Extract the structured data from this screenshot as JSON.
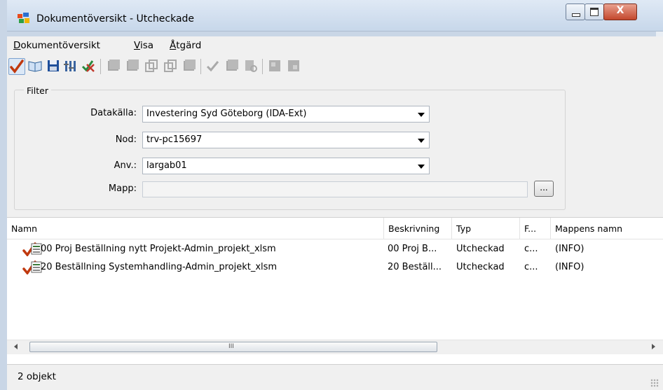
{
  "window": {
    "title": "Dokumentöversikt - Utcheckade",
    "close_glyph": "X"
  },
  "menu": [
    {
      "label_rest": "okumentöversikt",
      "mnemonic": "D"
    },
    {
      "label_rest": "isa",
      "mnemonic": "V"
    },
    {
      "label_rest": "tgärd",
      "mnemonic": "Å"
    }
  ],
  "filter": {
    "legend": "Filter",
    "datakalla_label": "Datakälla:",
    "datakalla_value": "Investering Syd Göteborg (IDA-Ext)",
    "nod_label": "Nod:",
    "nod_value": "trv-pc15697",
    "anv_label": "Anv.:",
    "anv_value": "largab01",
    "mapp_label": "Mapp:",
    "mapp_value": "",
    "browse_label": "..."
  },
  "list": {
    "columns": [
      "Namn",
      "Beskrivning",
      "Typ",
      "F...",
      "Mappens namn"
    ],
    "rows": [
      {
        "namn": "00 Proj Beställning nytt Projekt-Admin_projekt_xlsm",
        "beskrivning": "00 Proj B...",
        "typ": "Utcheckad",
        "f": "c...",
        "mapp": "(INFO)"
      },
      {
        "namn": "20 Beställning Systemhandling-Admin_projekt_xlsm",
        "beskrivning": "20 Beställ...",
        "typ": "Utcheckad",
        "f": "c...",
        "mapp": "(INFO)"
      }
    ],
    "scroll_grip": "III"
  },
  "status": {
    "text": "2 objekt"
  },
  "colors": {
    "checkmark": "#c0390f",
    "accent_blue": "#1e5aa8"
  }
}
